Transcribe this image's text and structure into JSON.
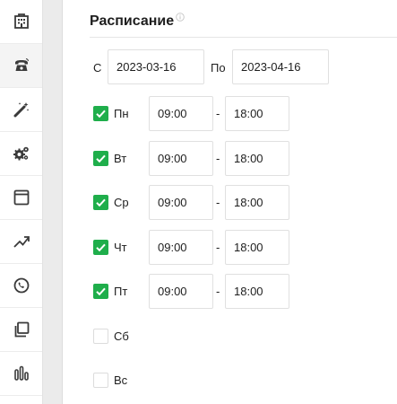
{
  "sidebar": {
    "items": [
      {
        "icon": "building-icon"
      },
      {
        "icon": "phone-icon",
        "active": true
      },
      {
        "icon": "magic-wand-icon"
      },
      {
        "icon": "gears-icon"
      },
      {
        "icon": "window-icon"
      },
      {
        "icon": "trend-up-icon"
      },
      {
        "icon": "clock-icon"
      },
      {
        "icon": "layers-icon"
      },
      {
        "icon": "bar-chart-icon"
      }
    ]
  },
  "schedule": {
    "title": "Расписание",
    "from_label": "С",
    "from_date": "2023-03-16",
    "to_label": "По",
    "to_date": "2023-04-16",
    "dash": "-",
    "days": [
      {
        "label": "Пн",
        "checked": true,
        "start": "09:00",
        "end": "18:00"
      },
      {
        "label": "Вт",
        "checked": true,
        "start": "09:00",
        "end": "18:00"
      },
      {
        "label": "Ср",
        "checked": true,
        "start": "09:00",
        "end": "18:00"
      },
      {
        "label": "Чт",
        "checked": true,
        "start": "09:00",
        "end": "18:00"
      },
      {
        "label": "Пт",
        "checked": true,
        "start": "09:00",
        "end": "18:00"
      },
      {
        "label": "Сб",
        "checked": false
      },
      {
        "label": "Вс",
        "checked": false
      }
    ]
  },
  "colors": {
    "checkbox_on": "#1fae4b",
    "icon": "#3a3a3a"
  }
}
